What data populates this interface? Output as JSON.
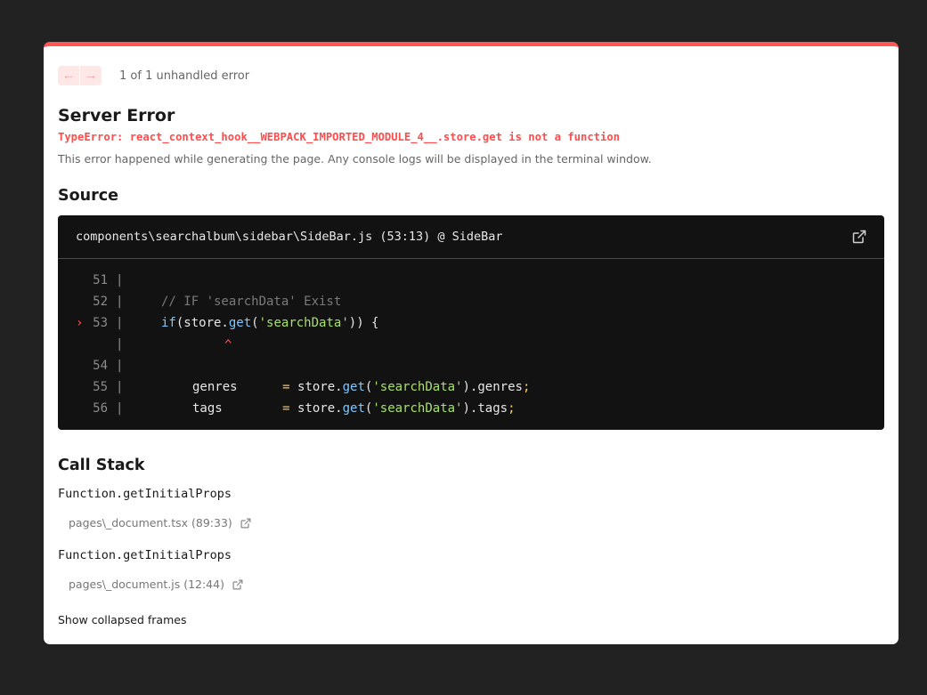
{
  "nav": {
    "prev_icon": "arrow-left-icon",
    "next_icon": "arrow-right-icon",
    "error_count": "1 of 1 unhandled error"
  },
  "error": {
    "title": "Server Error",
    "message": "TypeError: react_context_hook__WEBPACK_IMPORTED_MODULE_4__.store.get is not a function",
    "description": "This error happened while generating the page. Any console logs will be displayed in the terminal window."
  },
  "source": {
    "heading": "Source",
    "file": "components\\searchalbum\\sidebar\\SideBar.js (53:13) @ SideBar",
    "lines": [
      {
        "number": "51",
        "text": ""
      },
      {
        "number": "52",
        "text": "// IF 'searchData' Exist"
      },
      {
        "number": "53",
        "text": "if(store.get('searchData')) {"
      },
      {
        "number": "",
        "text": "^"
      },
      {
        "number": "54",
        "text": ""
      },
      {
        "number": "55",
        "text": "genres      = store.get('searchData').genres;"
      },
      {
        "number": "56",
        "text": "tags        = store.get('searchData').tags;"
      }
    ],
    "highlight_marker": "›",
    "gutter": "|"
  },
  "call_stack": {
    "heading": "Call Stack",
    "frames": [
      {
        "function": "Function.getInitialProps",
        "location": "pages\\_document.tsx (89:33)"
      },
      {
        "function": "Function.getInitialProps",
        "location": "pages\\_document.js (12:44)"
      }
    ],
    "show_collapsed": "Show collapsed frames"
  },
  "colors": {
    "accent": "#ff5555",
    "code_bg": "#121212",
    "page_bg": "#222222"
  }
}
